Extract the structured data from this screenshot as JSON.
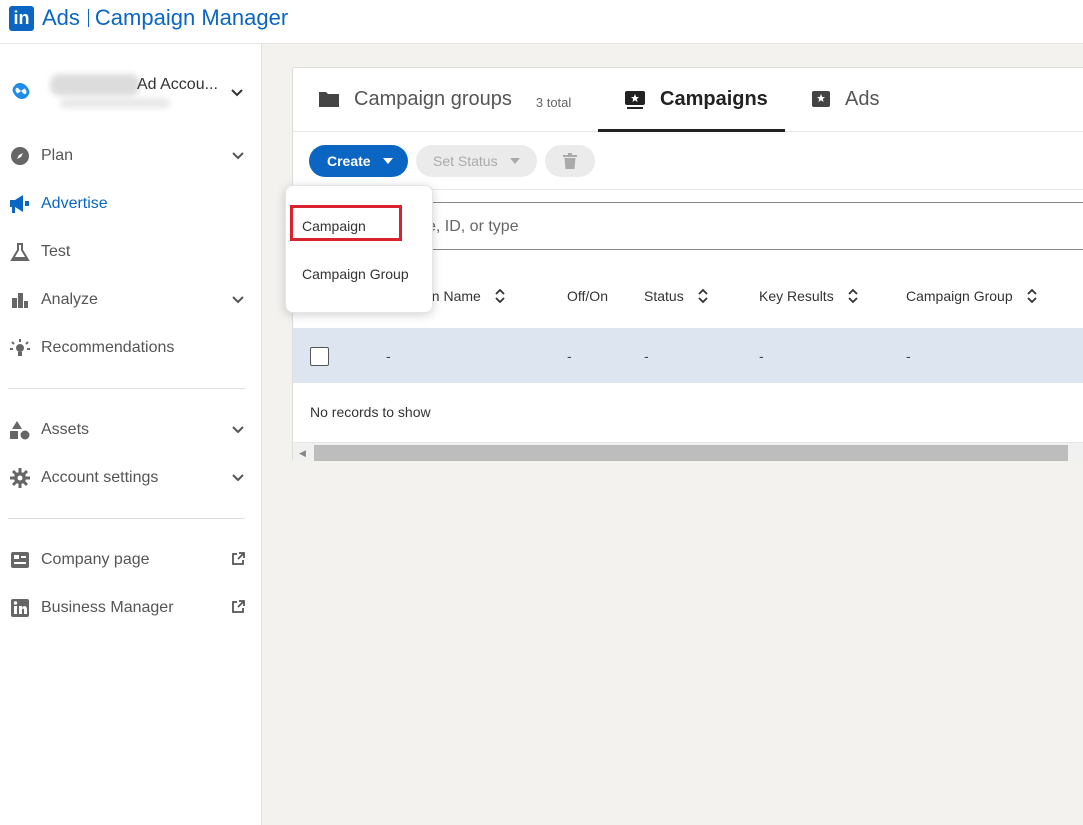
{
  "header": {
    "logo": "in",
    "product": "Ads",
    "app_name": "Campaign Manager"
  },
  "sidebar": {
    "account_label": "Ad Accou...",
    "items": [
      {
        "label": "Plan",
        "icon": "compass-icon",
        "expandable": true
      },
      {
        "label": "Advertise",
        "icon": "megaphone-icon",
        "active": true
      },
      {
        "label": "Test",
        "icon": "flask-icon"
      },
      {
        "label": "Analyze",
        "icon": "bar-chart-icon",
        "expandable": true
      },
      {
        "label": "Recommendations",
        "icon": "lightbulb-icon"
      },
      {
        "label": "Assets",
        "icon": "shapes-icon",
        "expandable": true
      },
      {
        "label": "Account settings",
        "icon": "gear-icon",
        "expandable": true
      },
      {
        "label": "Company page",
        "icon": "company-page-icon",
        "external": true
      },
      {
        "label": "Business Manager",
        "icon": "linkedin-icon",
        "external": true
      }
    ]
  },
  "tabs": [
    {
      "label": "Campaign groups",
      "count": "3 total"
    },
    {
      "label": "Campaigns",
      "active": true
    },
    {
      "label": "Ads"
    }
  ],
  "toolbar": {
    "create_label": "Create",
    "set_status_label": "Set Status"
  },
  "search": {
    "placeholder_visible": "e, ID, or type"
  },
  "table": {
    "columns": [
      "gn Name",
      "Off/On",
      "Status",
      "Key Results",
      "Campaign Group"
    ],
    "row": [
      "-",
      "-",
      "-",
      "-",
      "-"
    ],
    "empty_message": "No records to show"
  },
  "dropdown": {
    "items": [
      "Campaign",
      "Campaign Group"
    ]
  },
  "colors": {
    "brand": "#0a66c2",
    "highlight": "#d9232e",
    "row_bg": "#dde6f0"
  }
}
